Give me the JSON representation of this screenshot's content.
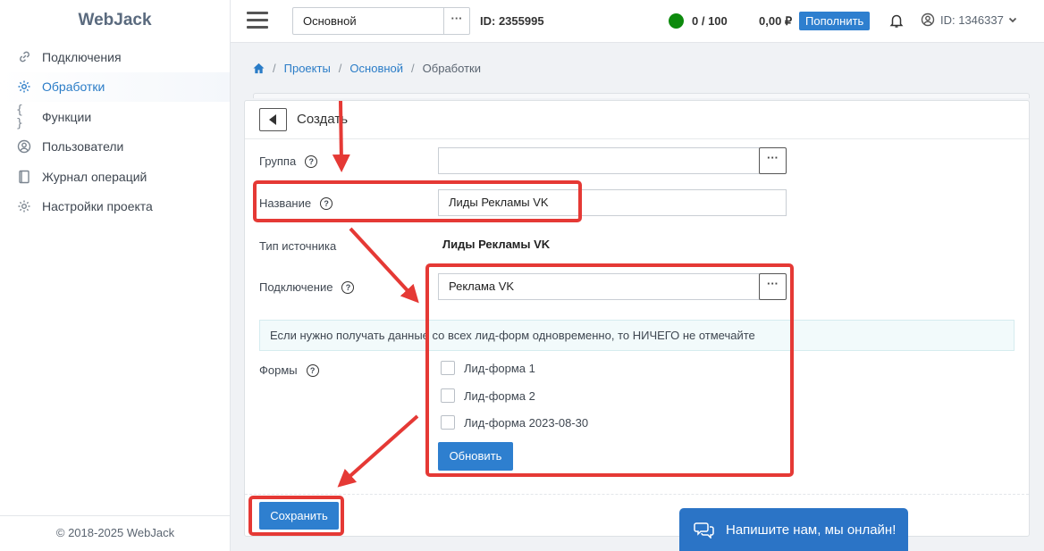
{
  "app": {
    "brand": "WebJack",
    "footer": "© 2018-2025 WebJack"
  },
  "sidebar": {
    "items": [
      {
        "label": "Подключения",
        "icon": "link-icon"
      },
      {
        "label": "Обработки",
        "icon": "gear-icon",
        "active": true
      },
      {
        "label": "Функции",
        "icon": "braces-icon"
      },
      {
        "label": "Пользователи",
        "icon": "user-circle-icon"
      },
      {
        "label": "Журнал операций",
        "icon": "journal-icon"
      },
      {
        "label": "Настройки проекта",
        "icon": "settings-icon"
      }
    ]
  },
  "topbar": {
    "project": "Основной",
    "project_more": "···",
    "project_id": "ID: 2355995",
    "status_count": "0 / 100",
    "status_color": "#0d8a0d",
    "balance": "0,00 ₽",
    "topup_label": "Пополнить",
    "user_id": "ID: 1346337"
  },
  "breadcrumb": {
    "items": [
      "Проекты",
      "Основной"
    ],
    "current": "Обработки"
  },
  "card": {
    "title": "Создать",
    "fields": {
      "group_label": "Группа",
      "group_value": "",
      "name_label": "Название",
      "name_value": "Лиды Рекламы VK",
      "source_type_label": "Тип источника",
      "source_type_value": "Лиды Рекламы VK",
      "connection_label": "Подключение",
      "connection_value": "Реклама VK",
      "forms_label": "Формы"
    },
    "info": "Если нужно получать данные со всех лид-форм одновременно, то НИЧЕГО не отмечайте",
    "forms": [
      "Лид-форма 1",
      "Лид-форма 2",
      "Лид-форма 2023-08-30"
    ],
    "refresh_label": "Обновить",
    "save_label": "Сохранить",
    "more": "···",
    "help": "?"
  },
  "chat": {
    "label": "Напишите нам, мы онлайн!"
  },
  "colors": {
    "accent": "#2e7fcf",
    "annotation": "#e53935"
  }
}
